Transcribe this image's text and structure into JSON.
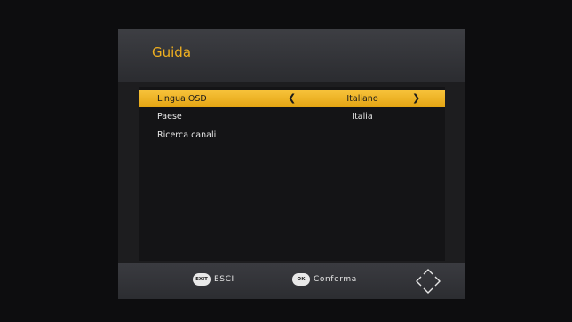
{
  "header": {
    "title": "Guida"
  },
  "menu": {
    "items": [
      {
        "label": "Lingua OSD",
        "value": "Italiano",
        "selected": true
      },
      {
        "label": "Paese",
        "value": "Italia",
        "selected": false
      },
      {
        "label": "Ricerca canali",
        "value": "",
        "selected": false
      }
    ],
    "left_arrow": "❮",
    "right_arrow": "❯"
  },
  "footer": {
    "exit_badge": "EXIT",
    "exit_label": "ESCI",
    "ok_badge": "OK",
    "ok_label": "Conferma",
    "nav_icon": "directional-pad-icon"
  },
  "colors": {
    "accent": "#f0b020",
    "highlight": "#f1b52b",
    "background": "#0d0d0f",
    "panel": "#1d1d1f"
  }
}
